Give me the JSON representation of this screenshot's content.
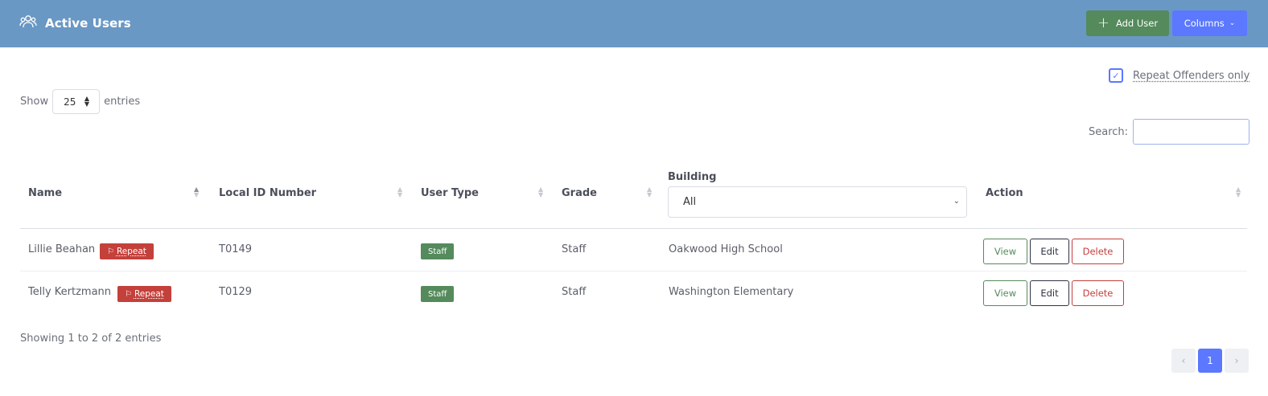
{
  "header": {
    "title": "Active Users",
    "add_user_label": "Add User",
    "columns_label": "Columns",
    "icon": "users-icon"
  },
  "filters": {
    "repeat_offenders_label": "Repeat Offenders only",
    "repeat_offenders_checked": true,
    "show_label": "Show",
    "entries_label": "entries",
    "page_size": "25",
    "search_label": "Search:",
    "search_value": ""
  },
  "table": {
    "columns": [
      "Name",
      "Local ID Number",
      "User Type",
      "Grade",
      "Building",
      "Action"
    ],
    "building_filter": "All",
    "sorted_column": "Name",
    "sort_direction": "ascending",
    "rows": [
      {
        "name": "Lillie Beahan",
        "badge": "Repeat",
        "local_id": "T0149",
        "user_type": "Staff",
        "grade": "Staff",
        "building": "Oakwood High School",
        "actions": [
          "View",
          "Edit",
          "Delete"
        ]
      },
      {
        "name": "Telly Kertzmann",
        "badge": "Repeat",
        "local_id": "T0129",
        "user_type": "Staff",
        "grade": "Staff",
        "building": "Washington Elementary",
        "actions": [
          "View",
          "Edit",
          "Delete"
        ]
      }
    ]
  },
  "footer": {
    "showing_text": "Showing 1 to 2 of 2 entries",
    "current_page": "1",
    "prev_label": "‹",
    "next_label": "›"
  },
  "colors": {
    "header_bg": "#6a98c4",
    "success": "#548a5c",
    "primary": "#5b78ff",
    "danger": "#c4403b"
  }
}
